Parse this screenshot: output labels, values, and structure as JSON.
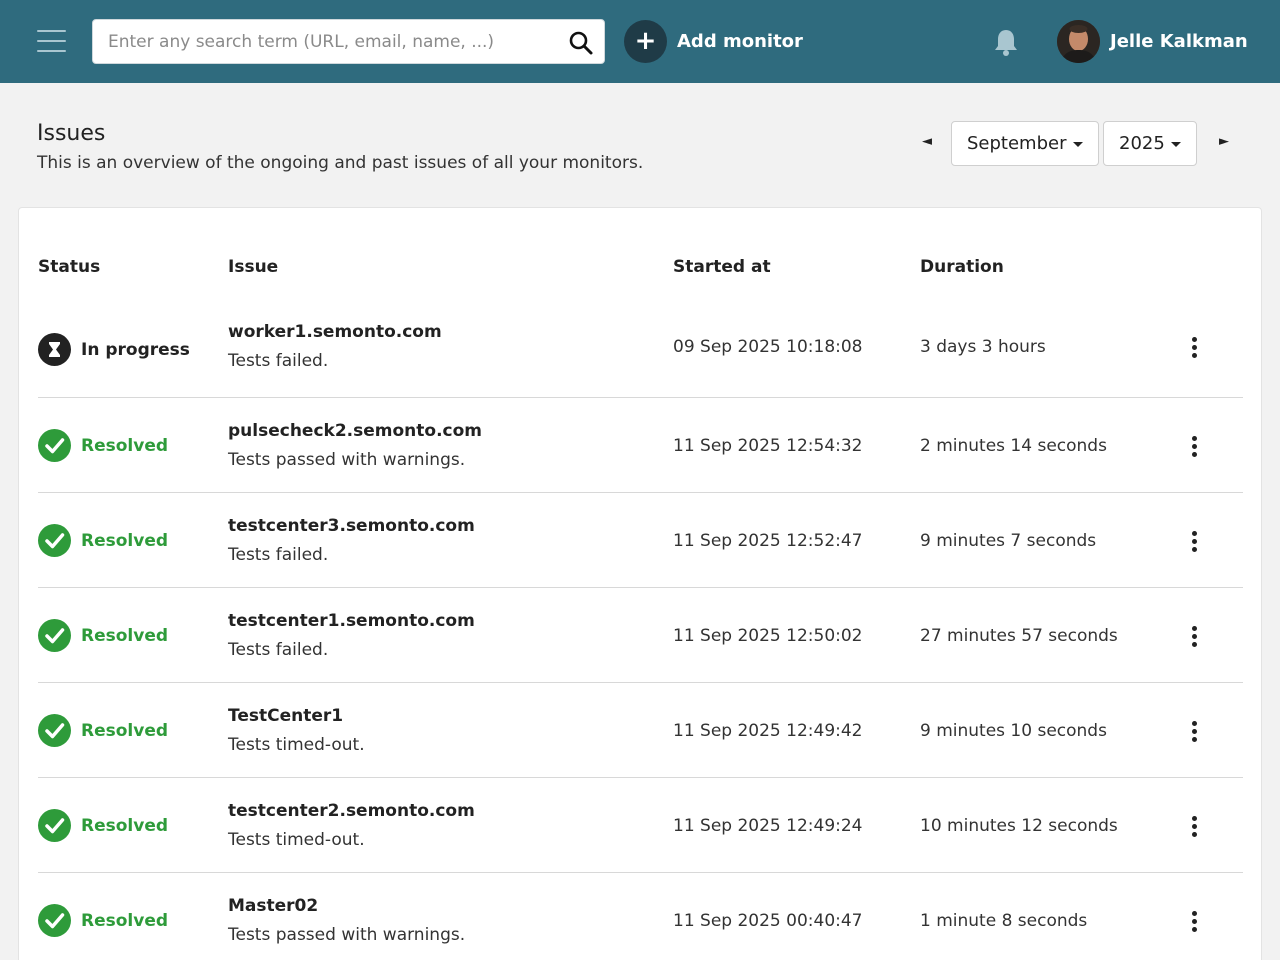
{
  "header": {
    "search_placeholder": "Enter any search term (URL, email, name, ...)",
    "add_monitor_label": "Add monitor",
    "user_name": "Jelle Kalkman",
    "bg_color": "#2f6b7e"
  },
  "page": {
    "title": "Issues",
    "subtitle": "This is an overview of the ongoing and past issues of all your monitors.",
    "prev_icon": "triangle-left-icon",
    "next_icon": "triangle-right-icon",
    "month": "September",
    "year": "2025"
  },
  "table": {
    "columns": {
      "status": "Status",
      "issue": "Issue",
      "started": "Started at",
      "duration": "Duration"
    },
    "rows": [
      {
        "status": "In progress",
        "status_type": "progress",
        "name": "worker1.semonto.com",
        "desc": "Tests failed.",
        "started": "09 Sep 2025 10:18:08",
        "duration": "3 days 3 hours"
      },
      {
        "status": "Resolved",
        "status_type": "resolved",
        "name": "pulsecheck2.semonto.com",
        "desc": "Tests passed with warnings.",
        "started": "11 Sep 2025 12:54:32",
        "duration": "2 minutes 14 seconds"
      },
      {
        "status": "Resolved",
        "status_type": "resolved",
        "name": "testcenter3.semonto.com",
        "desc": "Tests failed.",
        "started": "11 Sep 2025 12:52:47",
        "duration": "9 minutes 7 seconds"
      },
      {
        "status": "Resolved",
        "status_type": "resolved",
        "name": "testcenter1.semonto.com",
        "desc": "Tests failed.",
        "started": "11 Sep 2025 12:50:02",
        "duration": "27 minutes 57 seconds"
      },
      {
        "status": "Resolved",
        "status_type": "resolved",
        "name": "TestCenter1",
        "desc": "Tests timed-out.",
        "started": "11 Sep 2025 12:49:42",
        "duration": "9 minutes 10 seconds"
      },
      {
        "status": "Resolved",
        "status_type": "resolved",
        "name": "testcenter2.semonto.com",
        "desc": "Tests timed-out.",
        "started": "11 Sep 2025 12:49:24",
        "duration": "10 minutes 12 seconds"
      },
      {
        "status": "Resolved",
        "status_type": "resolved",
        "name": "Master02",
        "desc": "Tests passed with warnings.",
        "started": "11 Sep 2025 00:40:47",
        "duration": "1 minute 8 seconds"
      }
    ]
  },
  "colors": {
    "resolved": "#2e9b3a",
    "progress_icon": "#222222"
  }
}
